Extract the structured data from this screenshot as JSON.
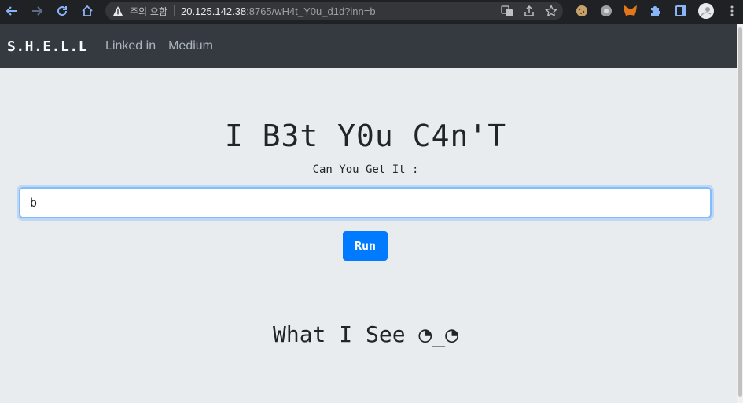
{
  "browser": {
    "security_label": "주의 요함",
    "url_host": "20.125.142.38",
    "url_rest": ":8765/wH4t_Y0u_d1d?inn=b",
    "icons": [
      "back-icon",
      "forward-icon",
      "reload-icon",
      "home-icon",
      "translate-icon",
      "share-icon",
      "bookmark-star-icon",
      "cookie-extension-icon",
      "extension-icon",
      "metamask-icon",
      "puzzle-icon",
      "sidebar-icon",
      "profile-avatar"
    ]
  },
  "navbar": {
    "brand": "S.H.E.L.L",
    "links": [
      "Linked in",
      "Medium"
    ]
  },
  "main": {
    "heading": "I B3t Y0u C4n'T",
    "prompt": "Can You Get It :",
    "input_value": "b",
    "run_label": "Run",
    "output_heading": "What I See ◔_◔"
  },
  "colors": {
    "navbar_bg": "#343a40",
    "page_bg": "#e9ecef",
    "button_bg": "#007bff",
    "chrome_bg": "#202124"
  }
}
